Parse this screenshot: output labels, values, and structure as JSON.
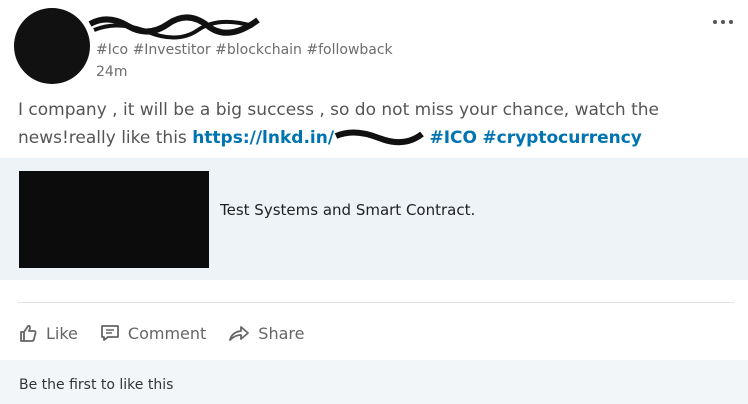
{
  "post": {
    "subtitle": "#Ico #Investitor #blockchain #followback",
    "time": "24m",
    "text_part1": "I company , it will be a big success , so do not miss your chance, watch the news!really like this ",
    "link": "https://lnkd.in/",
    "tag1": "#ICO",
    "tag2": "#cryptocurrency"
  },
  "card": {
    "title": "Test Systems and Smart Contract."
  },
  "actions": {
    "like": "Like",
    "comment": "Comment",
    "share": "Share"
  },
  "footer": {
    "text": "Be the first to like this"
  },
  "icons": {
    "more": "more-options-icon",
    "like": "thumbs-up-icon",
    "comment": "comment-icon",
    "share": "share-arrow-icon"
  }
}
